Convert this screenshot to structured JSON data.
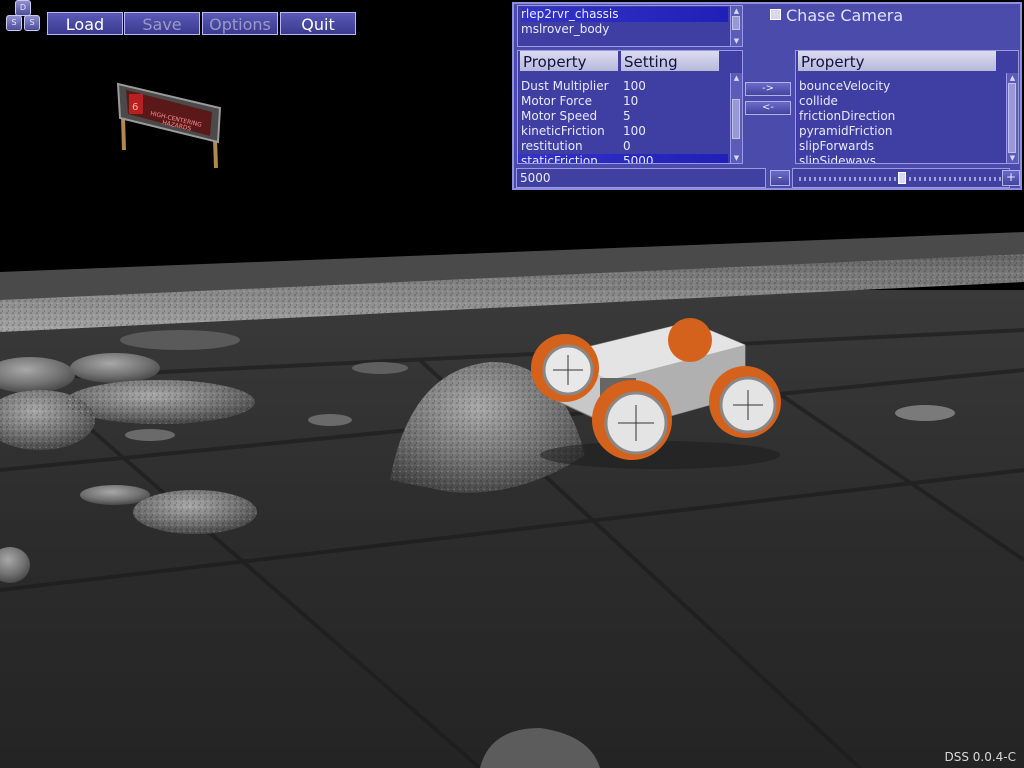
{
  "logo": {
    "letters": [
      "D",
      "S",
      "S"
    ]
  },
  "menu": {
    "load": "Load",
    "save": "Save",
    "options": "Options",
    "quit": "Quit"
  },
  "bodies": [
    "rlep2rvr_chassis",
    "mslrover_body"
  ],
  "chase_camera": {
    "label": "Chase Camera",
    "checked": false
  },
  "left_table": {
    "headers": [
      "Property",
      "Setting"
    ],
    "rows": [
      {
        "property": "Dust Multiplier",
        "setting": "100"
      },
      {
        "property": "Motor Force",
        "setting": "10"
      },
      {
        "property": "Motor Speed",
        "setting": "5"
      },
      {
        "property": "kineticFriction",
        "setting": "100"
      },
      {
        "property": "restitution",
        "setting": "0"
      },
      {
        "property": "staticFriction",
        "setting": "5000"
      }
    ],
    "selected_index": 5
  },
  "transfer": {
    "add": "->",
    "remove": "<-"
  },
  "right_table": {
    "header": "Property",
    "rows": [
      "bounceVelocity",
      "collide",
      "frictionDirection",
      "pyramidFriction",
      "slipForwards",
      "slipSideways"
    ]
  },
  "value_field": "5000",
  "slider": {
    "minus": "-",
    "plus": "+",
    "position": 0.5
  },
  "sign": {
    "number": "6",
    "line1": "HIGH-CENTERING",
    "line2": "HAZARDS"
  },
  "version": "DSS 0.0.4-C",
  "colors": {
    "panel": "#4b4bab",
    "selection": "#2a2ac0",
    "wheel": "#d4621c"
  }
}
